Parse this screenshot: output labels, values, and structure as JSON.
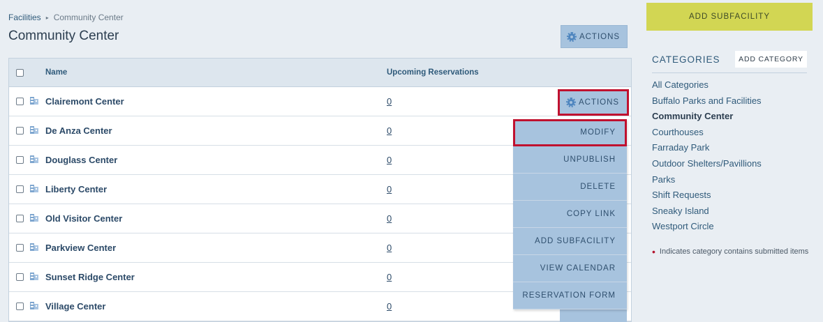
{
  "breadcrumb": {
    "parent": "Facilities",
    "separator": "▸",
    "current": "Community Center"
  },
  "page_title": "Community Center",
  "top_actions_label": "ACTIONS",
  "table": {
    "headers": {
      "name": "Name",
      "reservations": "Upcoming Reservations"
    },
    "rows": [
      {
        "name": "Clairemont Center",
        "reservations": "0"
      },
      {
        "name": "De Anza Center",
        "reservations": "0"
      },
      {
        "name": "Douglass Center",
        "reservations": "0"
      },
      {
        "name": "Liberty Center",
        "reservations": "0"
      },
      {
        "name": "Old Visitor Center",
        "reservations": "0"
      },
      {
        "name": "Parkview Center",
        "reservations": "0"
      },
      {
        "name": "Sunset Ridge Center",
        "reservations": "0"
      },
      {
        "name": "Village Center",
        "reservations": "0"
      }
    ]
  },
  "row_actions_label": "ACTIONS",
  "dropdown": {
    "items": [
      {
        "label": "MODIFY"
      },
      {
        "label": "UNPUBLISH"
      },
      {
        "label": "DELETE"
      },
      {
        "label": "COPY LINK"
      },
      {
        "label": "ADD SUBFACILITY"
      },
      {
        "label": "VIEW CALENDAR"
      },
      {
        "label": "RESERVATION FORM"
      }
    ]
  },
  "sidebar": {
    "add_subfacility": "ADD SUBFACILITY",
    "categories_title": "CATEGORIES",
    "add_category": "ADD CATEGORY",
    "categories": [
      "All Categories",
      "Buffalo Parks and Facilities",
      "Community Center",
      "Courthouses",
      "Farraday Park",
      "Outdoor Shelters/Pavillions",
      "Parks",
      "Shift Requests",
      "Sneaky Island",
      "Westport Circle"
    ],
    "active_category": "Community Center",
    "note": "Indicates category contains submitted items"
  },
  "colors": {
    "accent_button": "#a7c3de",
    "add_subfacility": "#d2d653",
    "highlight": "#c0112f",
    "link": "#2f5a7a"
  },
  "icons": {
    "actions": "gear-icon",
    "facility": "building-icon",
    "breadcrumb_separator": "triangle-right-icon",
    "note_marker": "red-dot-icon"
  }
}
